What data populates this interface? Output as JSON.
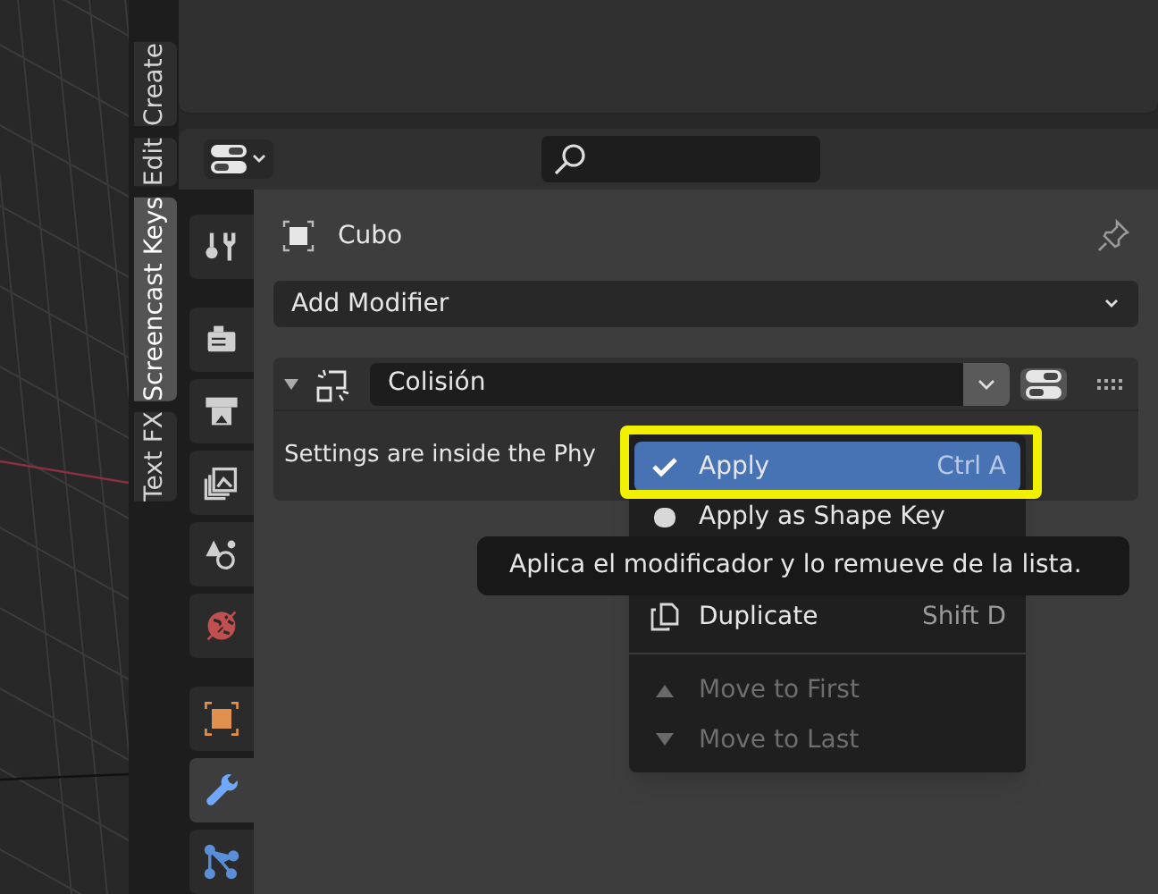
{
  "sidebar_tabs": [
    {
      "label": "Create",
      "selected": false
    },
    {
      "label": "Edit",
      "selected": false
    },
    {
      "label": "Screencast Keys",
      "selected": true
    },
    {
      "label": "Text FX",
      "selected": false
    }
  ],
  "property_tabs": [
    {
      "kind": "tool",
      "selected": false
    },
    {
      "kind": "render",
      "selected": false
    },
    {
      "kind": "output",
      "selected": false
    },
    {
      "kind": "view_layer",
      "selected": false
    },
    {
      "kind": "scene",
      "selected": false
    },
    {
      "kind": "world",
      "selected": false
    },
    {
      "kind": "object",
      "selected": false
    },
    {
      "kind": "modifiers",
      "selected": true
    },
    {
      "kind": "particles",
      "selected": false
    }
  ],
  "object_name": "Cubo",
  "add_modifier": "Add Modifier",
  "modifier": {
    "name": "Colisión",
    "expanded": true,
    "body": "Settings are inside the Phy"
  },
  "menu": [
    {
      "kind": "apply",
      "label": "Apply",
      "shortcut": "Ctrl A",
      "selected": true,
      "disabled": false
    },
    {
      "kind": "shape_key",
      "label": "Apply as Shape Key",
      "selected": false,
      "disabled": false
    },
    {
      "kind": "covered"
    },
    {
      "kind": "duplicate",
      "label": "Duplicate",
      "shortcut": "Shift D",
      "selected": false,
      "disabled": false
    },
    {
      "kind": "separator"
    },
    {
      "kind": "move_up",
      "label": "Move to First",
      "selected": false,
      "disabled": true
    },
    {
      "kind": "move_down",
      "label": "Move to Last",
      "selected": false,
      "disabled": true
    }
  ],
  "tooltip": "Aplica el modificador y lo remueve de la lista."
}
